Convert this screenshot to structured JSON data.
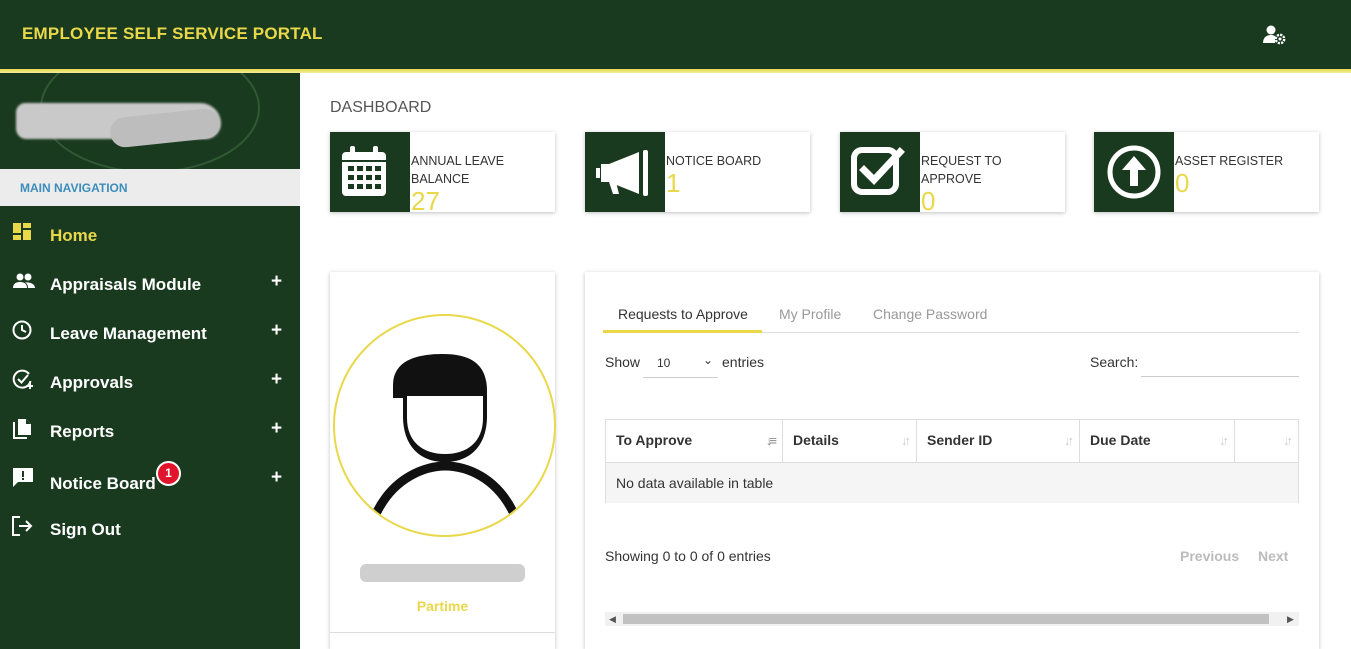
{
  "header": {
    "title": "EMPLOYEE SELF SERVICE PORTAL",
    "user_icon": "user-gear-icon"
  },
  "sidebar": {
    "nav_header": "MAIN NAVIGATION",
    "items": [
      {
        "label": "Home",
        "icon": "dashboard-icon",
        "active": true
      },
      {
        "label": "Appraisals Module",
        "icon": "people-icon",
        "expand": "+"
      },
      {
        "label": "Leave Management",
        "icon": "clock-icon",
        "expand": "+"
      },
      {
        "label": "Approvals",
        "icon": "check-circle-icon",
        "expand": "+"
      },
      {
        "label": "Reports",
        "icon": "documents-icon",
        "expand": "+"
      },
      {
        "label": "Notice Board",
        "icon": "message-alert-icon",
        "expand": "+",
        "badge": "1"
      },
      {
        "label": "Sign Out",
        "icon": "logout-icon"
      }
    ]
  },
  "main": {
    "title": "DASHBOARD",
    "tiles": [
      {
        "label": "ANNUAL LEAVE BALANCE",
        "value": "27",
        "icon": "calendar-icon"
      },
      {
        "label": "NOTICE BOARD",
        "value": "1",
        "icon": "megaphone-icon"
      },
      {
        "label": "REQUEST TO APPROVE",
        "value": "0",
        "icon": "checkbox-icon"
      },
      {
        "label": "ASSET REGISTER",
        "value": "0",
        "icon": "upload-circle-icon"
      }
    ],
    "profile": {
      "role": "Partime"
    },
    "requests": {
      "tabs": [
        {
          "label": "Requests to Approve",
          "active": true
        },
        {
          "label": "My Profile"
        },
        {
          "label": "Change Password"
        }
      ],
      "show_label": "Show",
      "page_size": "10",
      "entries_label": "entries",
      "search_label": "Search:",
      "columns": [
        "To Approve",
        "Details",
        "Sender ID",
        "Due Date",
        ""
      ],
      "empty_message": "No data available in table",
      "info": "Showing 0 to 0 of 0 entries",
      "prev_label": "Previous",
      "next_label": "Next"
    }
  },
  "colors": {
    "primary": "#1a3a1f",
    "accent": "#e8d84a",
    "badge": "#e0142a",
    "link": "#3c8dbc"
  }
}
